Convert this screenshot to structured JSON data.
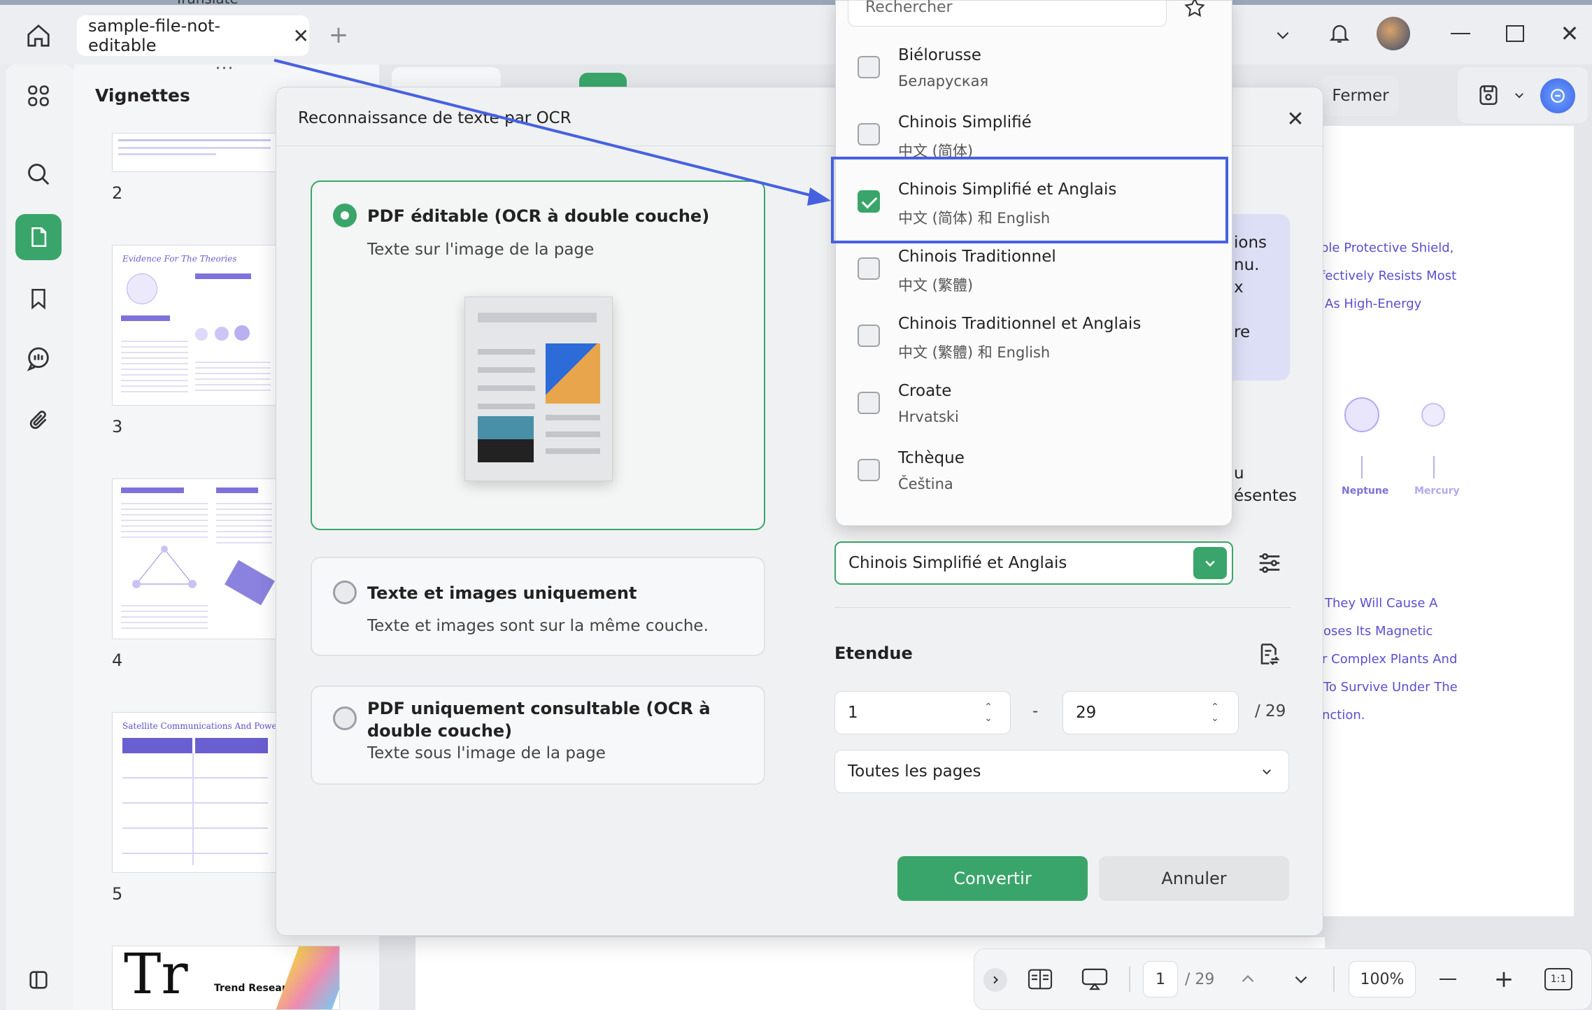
{
  "window": {
    "tab_title": "sample-file-not-editable",
    "partial_top_text": "Translate"
  },
  "sidebar": {
    "panel_title": "Vignettes",
    "page_numbers": [
      "2",
      "3",
      "4",
      "5"
    ],
    "thumb_titles": {
      "p3": "Evidence For The Theories",
      "p5": "Satellite Communications And Power Gri",
      "p6": "Trend Research"
    }
  },
  "toolbar": {
    "close_label": "Fermer"
  },
  "document": {
    "lines_top": [
      "ble Protective Shield,",
      "fectively Resists Most",
      "As High-Energy"
    ],
    "planets": [
      "Neptune",
      "Mercury"
    ],
    "lines_bottom": [
      "They Will Cause A",
      "oses Its Magnetic",
      "r Complex Plants And",
      "To Survive Under The",
      "nction."
    ],
    "partial_right_text": [
      "ions",
      "nu.",
      "x",
      "re",
      "u",
      "ésentes"
    ]
  },
  "dialog": {
    "title": "Reconnaissance de texte par OCR",
    "options": [
      {
        "title": "PDF éditable (OCR à double couche)",
        "subtitle": "Texte sur l'image de la page",
        "selected": true
      },
      {
        "title": "Texte et images uniquement",
        "subtitle": "Texte et images sont sur la même couche.",
        "selected": false
      },
      {
        "title": "PDF uniquement consultable (OCR à double couche)",
        "subtitle": "Texte sous l'image de la page",
        "selected": false
      }
    ],
    "language_value": "Chinois Simplifié et Anglais",
    "range_label": "Etendue",
    "range_from": "1",
    "range_sep": "-",
    "range_to": "29",
    "range_total": "/ 29",
    "pages_value": "Toutes les pages",
    "convert_label": "Convertir",
    "cancel_label": "Annuler"
  },
  "dropdown": {
    "search_placeholder": "Rechercher",
    "items": [
      {
        "name": "Biélorusse",
        "native": "Беларуская",
        "checked": false
      },
      {
        "name": "Chinois Simplifié",
        "native": "中文 (简体)",
        "checked": false
      },
      {
        "name": "Chinois Simplifié et Anglais",
        "native": "中文 (简体) 和 English",
        "checked": true
      },
      {
        "name": "Chinois Traditionnel",
        "native": "中文 (繁體)",
        "checked": false
      },
      {
        "name": "Chinois Traditionnel et Anglais",
        "native": "中文 (繁體) 和 English",
        "checked": false
      },
      {
        "name": "Croate",
        "native": "Hrvatski",
        "checked": false
      },
      {
        "name": "Tchèque",
        "native": "Čeština",
        "checked": false
      }
    ]
  },
  "bottombar": {
    "page_current": "1",
    "page_total": "/ 29",
    "zoom": "100%",
    "fit_label": "1:1"
  },
  "colors": {
    "accent": "#3aa56a",
    "highlight": "#4661e0",
    "doc_text": "#5b4fd0"
  }
}
